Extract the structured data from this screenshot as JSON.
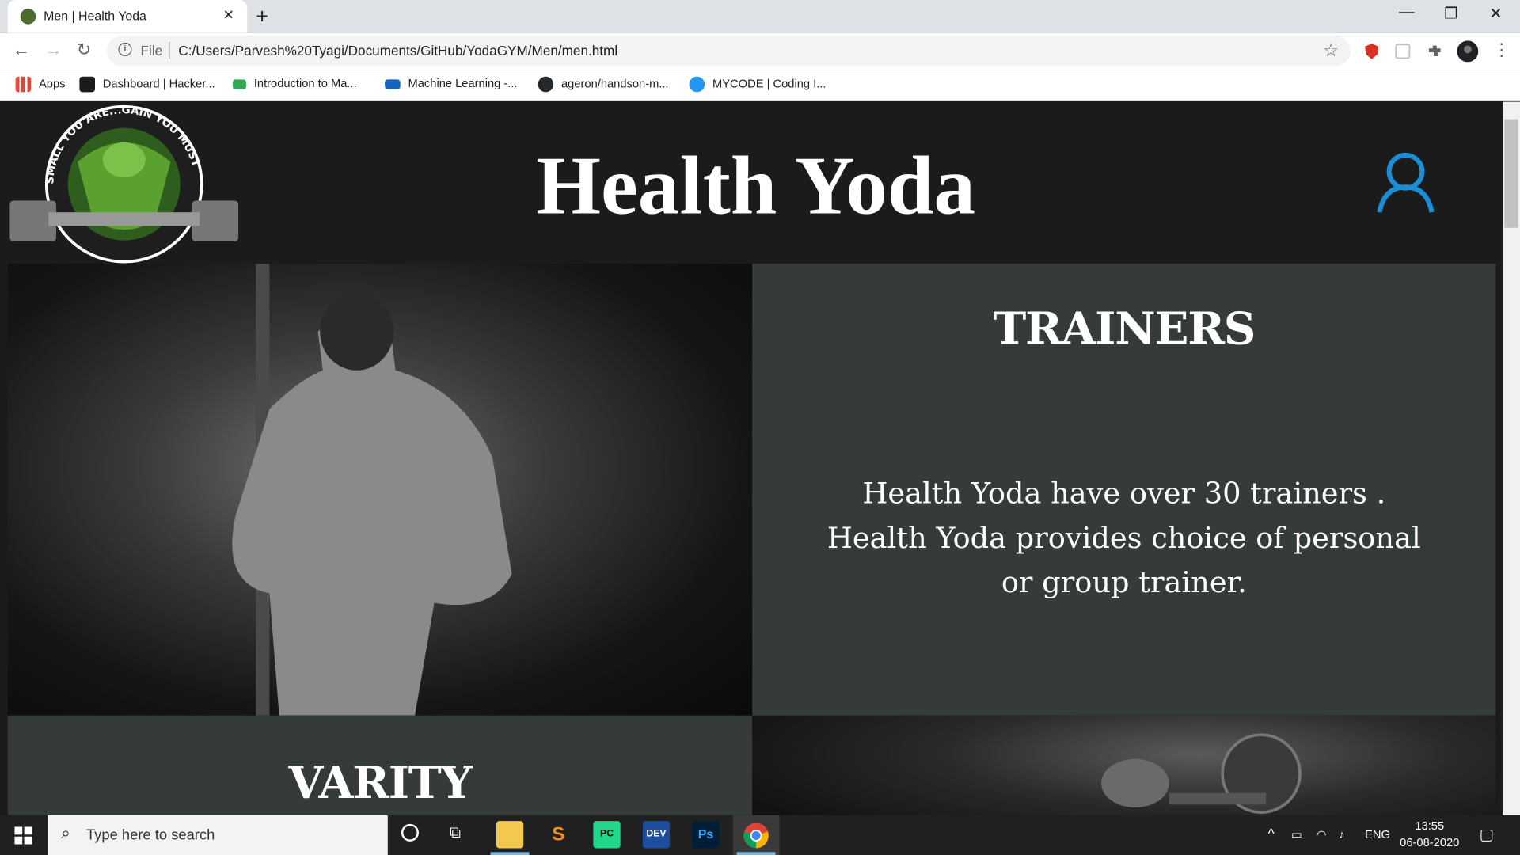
{
  "browser": {
    "tab_title": "Men | Health Yoda",
    "new_tab": "+",
    "url_scheme_label": "File",
    "url": "C:/Users/Parvesh%20Tyagi/Documents/GitHub/YodaGYM/Men/men.html",
    "bookmarks": [
      {
        "label": "Apps",
        "color": "#4285f4"
      },
      {
        "label": "Dashboard | Hacker...",
        "color": "#1a1a1a"
      },
      {
        "label": "Introduction to Ma...",
        "color": "#34a853"
      },
      {
        "label": "Machine Learning -...",
        "color": "#1565c0"
      },
      {
        "label": "ageron/handson-m...",
        "color": "#24292e"
      },
      {
        "label": "MYCODE | Coding I...",
        "color": "#2196f3"
      }
    ]
  },
  "site": {
    "title": "Health Yoda",
    "logo_text": "SMALL YOU ARE...GAIN YOU MUST",
    "accent": "#1a8fd8",
    "sections": [
      {
        "heading": "TRAINERS",
        "body": "Health Yoda have over 30 trainers . Health Yoda provides choice of personal or group trainer."
      },
      {
        "heading": "VARITY"
      }
    ]
  },
  "taskbar": {
    "search_placeholder": "Type here to search",
    "apps": [
      "file-explorer",
      "sublime-text",
      "pycharm",
      "dev-cpp",
      "photoshop",
      "chrome"
    ],
    "lang": "ENG",
    "time": "13:55",
    "date": "06-08-2020"
  }
}
